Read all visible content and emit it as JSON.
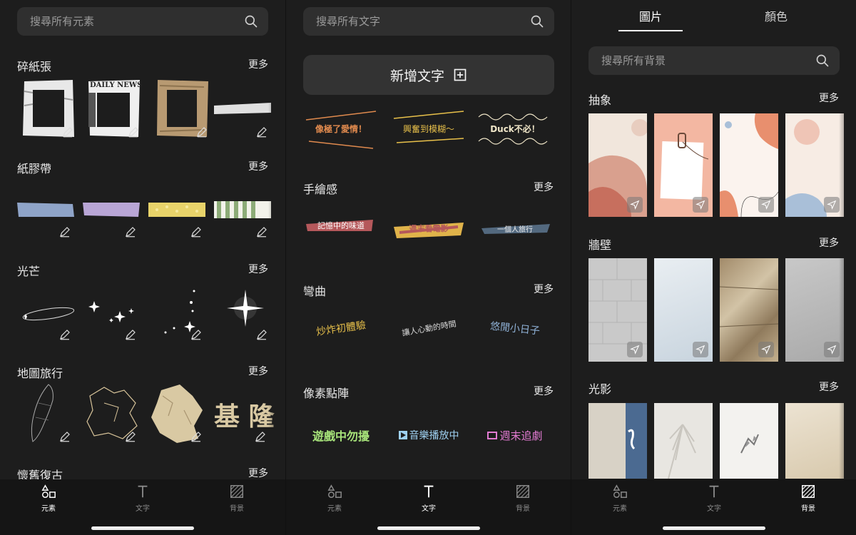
{
  "left_panel": {
    "search_placeholder": "搜尋所有元素",
    "sections": [
      {
        "title": "碎紙張",
        "more": "更多"
      },
      {
        "title": "紙膠帶",
        "more": "更多"
      },
      {
        "title": "光芒",
        "more": "更多"
      },
      {
        "title": "地圖旅行",
        "more": "更多"
      },
      {
        "title": "懷舊復古",
        "more": "更多"
      }
    ],
    "newspaper_text": "DAILY NEWS",
    "map_chars": "基 隆"
  },
  "middle_panel": {
    "search_placeholder": "搜尋所有文字",
    "add_text_label": "新增文字",
    "featured_samples": [
      "像極了愛情！",
      "興奮到模糊～",
      "Duck不必！"
    ],
    "sections": [
      {
        "title": "手繪感",
        "more": "更多",
        "samples": [
          "記憶中的味道",
          "週末看電影",
          "一個人旅行"
        ]
      },
      {
        "title": "彎曲",
        "more": "更多",
        "samples": [
          "炒炸初體驗",
          "讓人心動的時間",
          "悠閒小日子"
        ]
      },
      {
        "title": "像素點陣",
        "more": "更多",
        "samples": [
          "遊戲中勿擾",
          "音樂播放中",
          "週末追劇"
        ]
      }
    ]
  },
  "right_panel": {
    "tabs": [
      "圖片",
      "顏色"
    ],
    "search_placeholder": "搜尋所有背景",
    "sections": [
      {
        "title": "抽象",
        "more": "更多"
      },
      {
        "title": "牆壁",
        "more": "更多"
      },
      {
        "title": "光影",
        "more": "更多"
      }
    ]
  },
  "bottom_nav": {
    "items": [
      "元素",
      "文字",
      "背景"
    ]
  },
  "colors": {
    "panel_bg": "#1d1d1d",
    "input_bg": "#2f2f2f",
    "nav_bg": "#151515",
    "accent_text": "#ffffff"
  }
}
